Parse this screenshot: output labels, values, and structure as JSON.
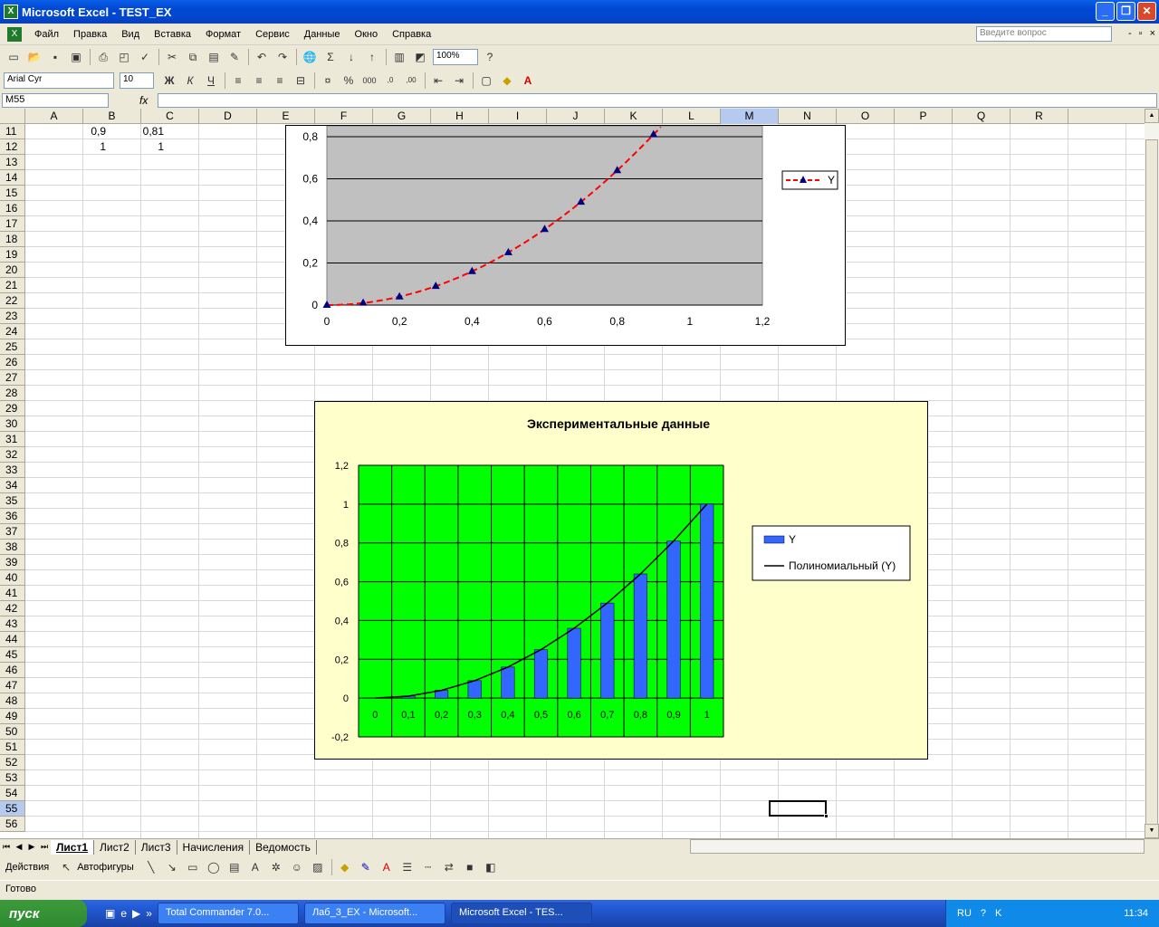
{
  "window": {
    "title": "Microsoft Excel - TEST_EX",
    "minimize": "_",
    "restore": "❐",
    "close": "✕"
  },
  "menu": {
    "items": [
      "Файл",
      "Правка",
      "Вид",
      "Вставка",
      "Формат",
      "Сервис",
      "Данные",
      "Окно",
      "Справка"
    ],
    "help_placeholder": "Введите вопрос"
  },
  "toolbar": {
    "zoom": "100%",
    "font_name": "Arial Cyr",
    "font_size": "10"
  },
  "formula_bar": {
    "name_box": "M55",
    "fx": "fx",
    "formula": ""
  },
  "sheet": {
    "columns": [
      "A",
      "B",
      "C",
      "D",
      "E",
      "F",
      "G",
      "H",
      "I",
      "J",
      "K",
      "L",
      "M",
      "N",
      "O",
      "P",
      "Q",
      "R"
    ],
    "selected_column": "M",
    "rows": [
      11,
      12,
      13,
      14,
      15,
      16,
      17,
      18,
      19,
      20,
      21,
      22,
      23,
      24,
      25,
      26,
      27,
      28,
      29,
      30,
      31,
      32,
      33,
      34,
      35,
      36,
      37,
      38,
      39,
      40,
      41,
      42,
      43,
      44,
      45,
      46,
      47,
      48,
      49,
      50,
      51,
      52,
      53,
      54,
      55,
      56
    ],
    "selected_row": 55,
    "cells": {
      "a11": "0,9",
      "b11": "0,81",
      "a12": "1",
      "b12": "1"
    }
  },
  "tabs": {
    "items": [
      "Лист1",
      "Лист2",
      "Лист3",
      "Начисления",
      "Ведомость"
    ],
    "active": "Лист1"
  },
  "drawing_toolbar": {
    "actions": "Действия",
    "autoshapes": "Автофигуры"
  },
  "status": {
    "text": "Готово"
  },
  "taskbar": {
    "start": "пуск",
    "tasks": [
      "Total Commander 7.0...",
      "Лаб_3_EX - Microsoft...",
      "Microsoft Excel - TES..."
    ],
    "active_task": 2,
    "lang": "RU",
    "time": "11:34"
  },
  "chart_data": [
    {
      "type": "scatter",
      "title": "",
      "x": [
        0,
        0.1,
        0.2,
        0.3,
        0.4,
        0.5,
        0.6,
        0.7,
        0.8,
        0.9
      ],
      "series": [
        {
          "name": "Y",
          "values": [
            0,
            0.01,
            0.04,
            0.09,
            0.16,
            0.25,
            0.36,
            0.49,
            0.64,
            0.81
          ]
        }
      ],
      "x_ticks": [
        "0",
        "0,2",
        "0,4",
        "0,6",
        "0,8",
        "1",
        "1,2"
      ],
      "y_ticks": [
        "0",
        "0,2",
        "0,4",
        "0,6",
        "0,8"
      ],
      "xlim": [
        0,
        1.2
      ],
      "ylim": [
        0,
        0.8
      ],
      "grid": true,
      "legend": "right",
      "colors": {
        "series": "#ff0000",
        "marker": "#000080",
        "plot_bg": "#c0c0c0",
        "frame": "#ffffff"
      }
    },
    {
      "type": "bar",
      "title": "Экспериментальные данные",
      "categories": [
        "0",
        "0,1",
        "0,2",
        "0,3",
        "0,4",
        "0,5",
        "0,6",
        "0,7",
        "0,8",
        "0,9",
        "1"
      ],
      "series": [
        {
          "name": "Y",
          "values": [
            0,
            0.01,
            0.04,
            0.09,
            0.16,
            0.25,
            0.36,
            0.49,
            0.64,
            0.81,
            1
          ]
        },
        {
          "name": "Полиномиальный (Y)",
          "values": [
            0,
            0.01,
            0.04,
            0.09,
            0.16,
            0.25,
            0.36,
            0.49,
            0.64,
            0.81,
            1
          ]
        }
      ],
      "y_ticks": [
        "-0,2",
        "0",
        "0,2",
        "0,4",
        "0,6",
        "0,8",
        "1",
        "1,2"
      ],
      "ylim": [
        -0.2,
        1.2
      ],
      "grid": true,
      "legend": "right",
      "colors": {
        "bar": "#3366ff",
        "trend": "#000000",
        "plot_bg": "#00ff00",
        "frame": "#ffffcc"
      }
    }
  ]
}
